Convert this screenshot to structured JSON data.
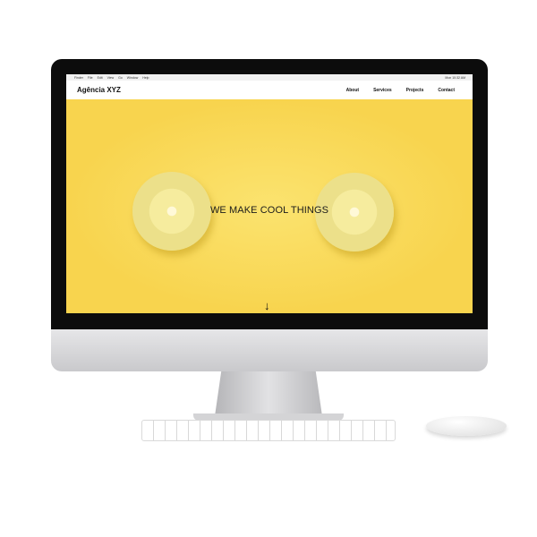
{
  "menubar": {
    "items": [
      "Finder",
      "File",
      "Edit",
      "View",
      "Go",
      "Window",
      "Help"
    ],
    "right": "Mon 10:32 AM"
  },
  "site": {
    "brand": "Agência XYZ",
    "nav": [
      "About",
      "Services",
      "Projects",
      "Contact"
    ],
    "hero_title": "WE MAKE COOL THINGS",
    "scroll_arrow": "↓"
  },
  "colors": {
    "hero_background": "#f8d44e",
    "header_background": "#ffffff",
    "text": "#111111"
  }
}
